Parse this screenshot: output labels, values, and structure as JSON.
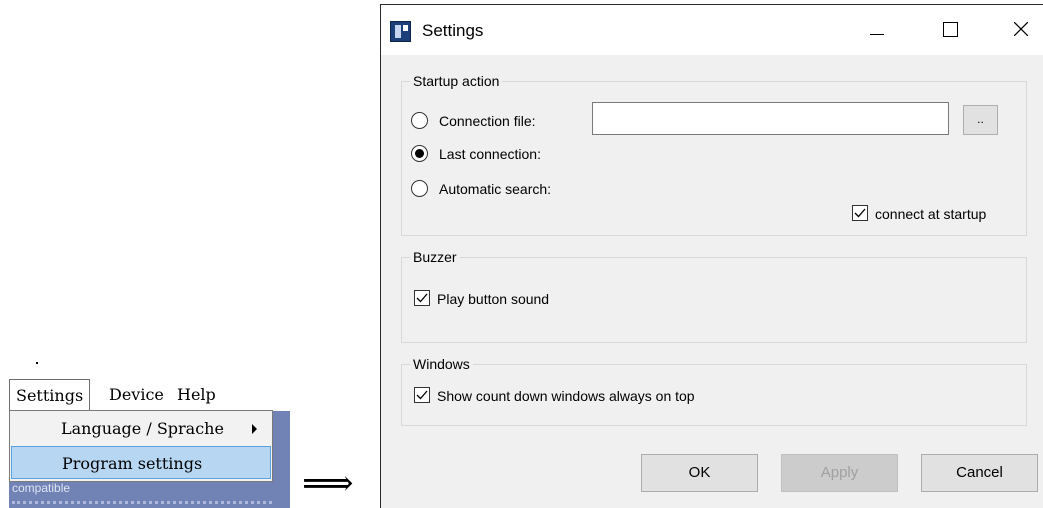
{
  "menu": {
    "bar_items": [
      "Settings",
      "Device",
      "Help"
    ],
    "dropdown_items": [
      "Language / Sprache",
      "Program settings"
    ],
    "app_background_text": "compatible"
  },
  "arrow_symbol": "⟹",
  "dialog": {
    "title": "Settings",
    "startup": {
      "group_title": "Startup action",
      "connection_file_label": "Connection file:",
      "connection_file_value": "",
      "browse_label": "..",
      "last_connection_label": "Last connection:",
      "automatic_search_label": "Automatic search:",
      "connect_at_startup_label": "connect at startup",
      "selected": "Last connection:",
      "connect_at_startup_checked": true
    },
    "buzzer": {
      "group_title": "Buzzer",
      "play_button_sound_label": "Play button sound",
      "checked": true
    },
    "windows": {
      "group_title": "Windows",
      "always_on_top_label": "Show count down windows always on top",
      "checked": true
    },
    "buttons": {
      "ok": "OK",
      "apply": "Apply",
      "cancel": "Cancel"
    }
  },
  "icons": {
    "app": "app-window-icon",
    "minimize": "minimize-icon",
    "maximize": "maximize-icon",
    "close": "close-icon",
    "submenu": "chevron-right-icon"
  }
}
